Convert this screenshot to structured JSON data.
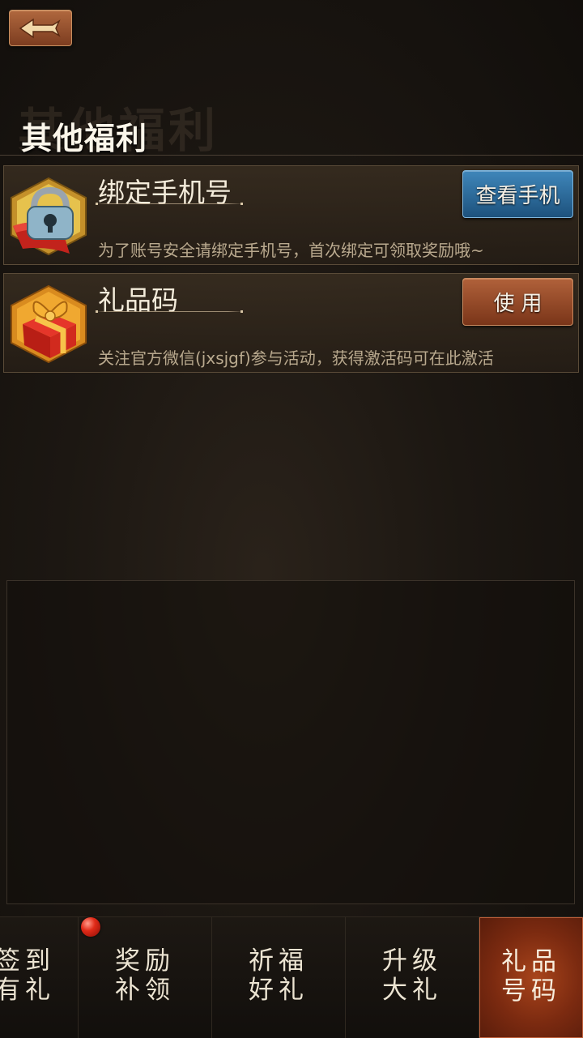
{
  "header": {
    "title": "其他福利",
    "title_shadow": "其他福利"
  },
  "items": [
    {
      "name": "绑定手机号",
      "desc": "为了账号安全请绑定手机号，首次绑定可领取奖励哦~",
      "button": "查看手机",
      "icon": "lock-icon"
    },
    {
      "name": "礼品码",
      "desc": "关注官方微信(jxsjgf)参与活动，获得激活码可在此激活",
      "button": "使用",
      "icon": "gift-icon"
    }
  ],
  "tabs": [
    {
      "line1": "签到",
      "line2": "有礼",
      "active": false
    },
    {
      "line1": "奖励",
      "line2": "补领",
      "active": false,
      "badge": true
    },
    {
      "line1": "祈福",
      "line2": "好礼",
      "active": false
    },
    {
      "line1": "升级",
      "line2": "大礼",
      "active": false
    },
    {
      "line1": "礼品",
      "line2": "号码",
      "active": true
    }
  ],
  "colors": {
    "accent_blue": "#2f6d9c",
    "accent_orange": "#9c4a2a",
    "active_tab": "#8a3012"
  }
}
